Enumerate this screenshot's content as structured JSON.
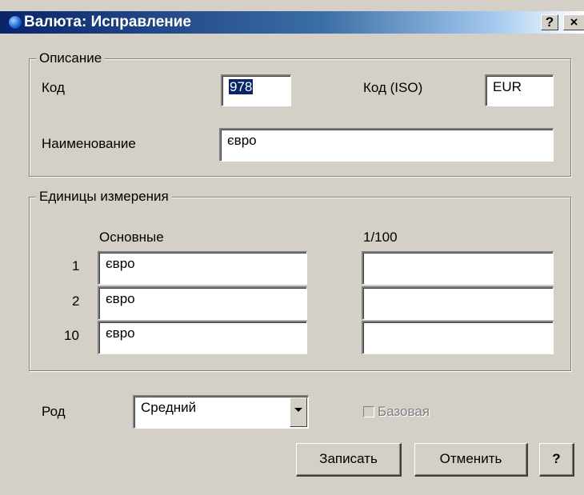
{
  "window": {
    "title": "Валюта: Исправление",
    "help_button": "?",
    "close_button": "×"
  },
  "description_group": {
    "legend": "Описание",
    "code_label": "Код",
    "code_value": "978",
    "iso_label": "Код (ISO)",
    "iso_value": "EUR",
    "name_label": "Наименование",
    "name_value": "євро"
  },
  "units_group": {
    "legend": "Единицы измерения",
    "main_header": "Основные",
    "fraction_header": "1/100",
    "rows": [
      {
        "qty": "1",
        "main": "євро",
        "fraction": ""
      },
      {
        "qty": "2",
        "main": "євро",
        "fraction": ""
      },
      {
        "qty": "10",
        "main": "євро",
        "fraction": ""
      }
    ]
  },
  "gender": {
    "label": "Род",
    "selected": "Средний"
  },
  "base_checkbox": {
    "label": "Базовая",
    "checked": false,
    "enabled": false
  },
  "buttons": {
    "save": "Записать",
    "cancel": "Отменить",
    "help": "?"
  }
}
